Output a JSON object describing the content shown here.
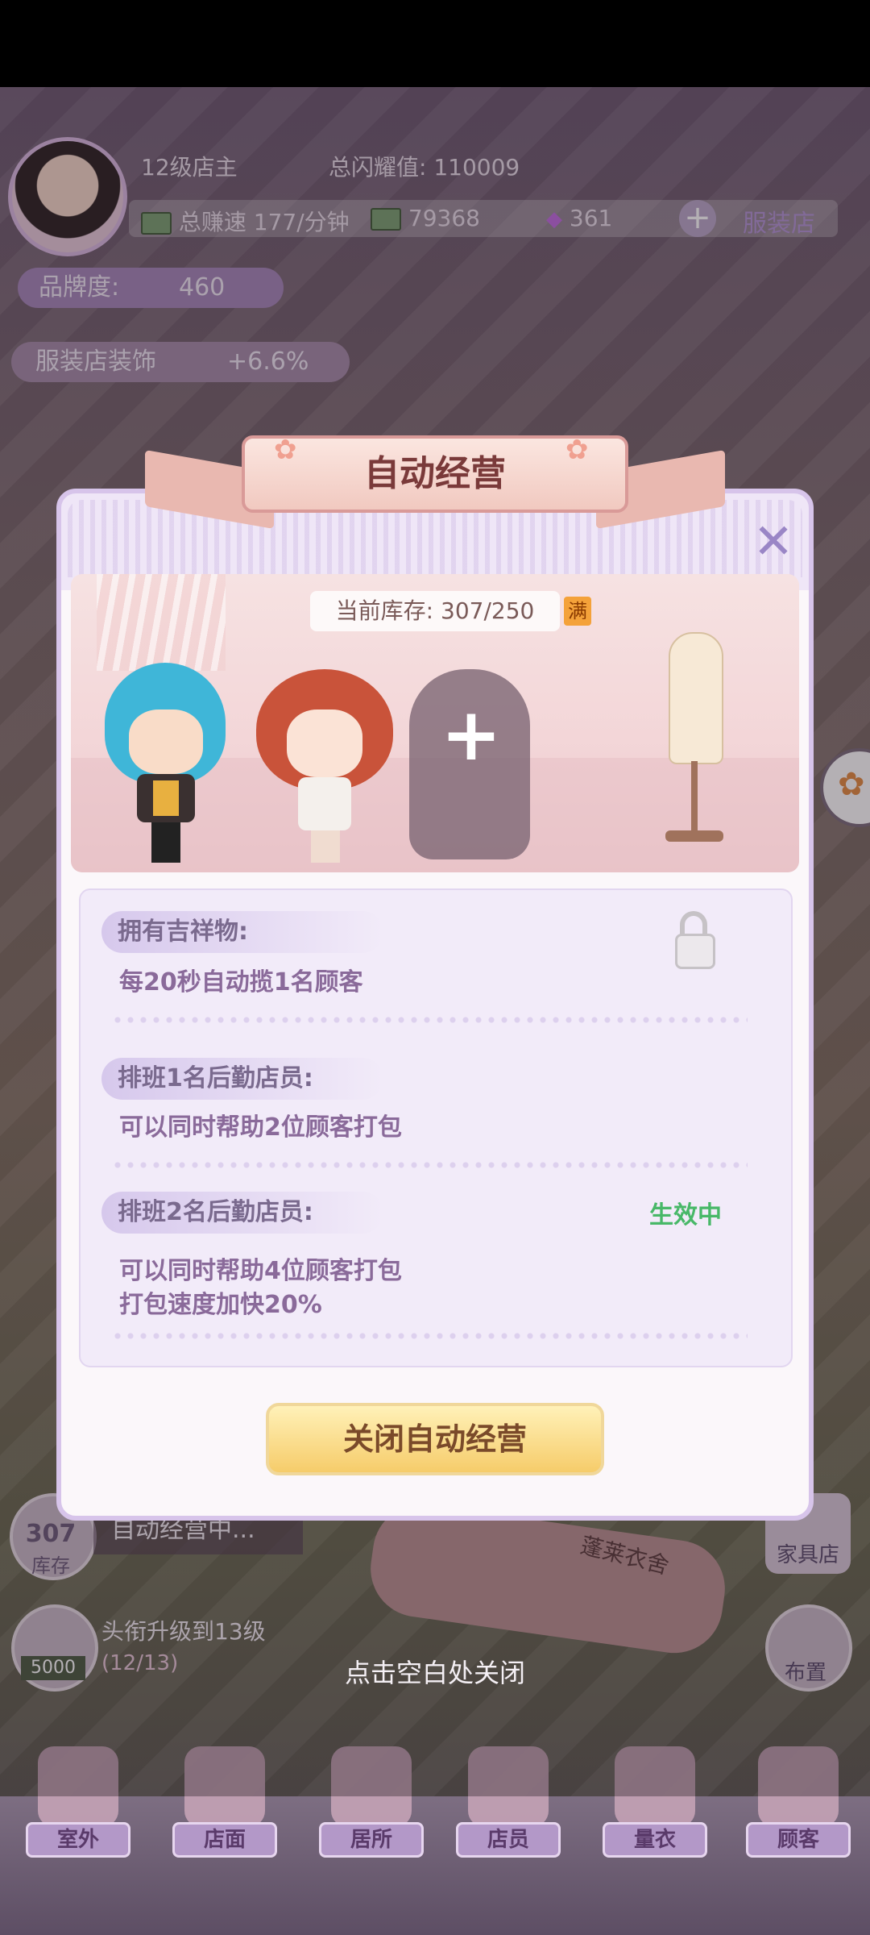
{
  "hud": {
    "level": "12级店主",
    "shine": "总闪耀值: 110009",
    "earn_speed": "总赚速 177/分钟",
    "cash": "79368",
    "gems": "361",
    "shop_name": "服装店",
    "brand_label": "品牌度:",
    "brand_value": "460",
    "deco_label": "服装店装饰",
    "deco_value": "+6.6%",
    "stock_count": "307",
    "stock_label": "库存",
    "auto_status": "自动经营中...",
    "cash_reward": "5000",
    "title_upgrade": "头衔升级到13级",
    "title_progress": "(12/13)",
    "furniture_label": "家具店",
    "layout_label": "布置",
    "sign_text": "蓬莱衣舍"
  },
  "dialog": {
    "title": "自动经营",
    "stock": "当前库存: 307/250",
    "full_badge": "满",
    "tiers": [
      {
        "tag": "拥有吉祥物:",
        "desc": "每20秒自动揽1名顾客"
      },
      {
        "tag": "排班1名后勤店员:",
        "desc": "可以同时帮助2位顾客打包"
      },
      {
        "tag": "排班2名后勤店员:",
        "desc": "可以同时帮助4位顾客打包",
        "desc2": "打包速度加快20%",
        "status": "生效中"
      }
    ],
    "close_button": "关闭自动经营"
  },
  "close_hint": "点击空白处关闭",
  "nav": [
    {
      "label": "室外"
    },
    {
      "label": "店面"
    },
    {
      "label": "居所"
    },
    {
      "label": "店员"
    },
    {
      "label": "量衣"
    },
    {
      "label": "顾客"
    }
  ]
}
